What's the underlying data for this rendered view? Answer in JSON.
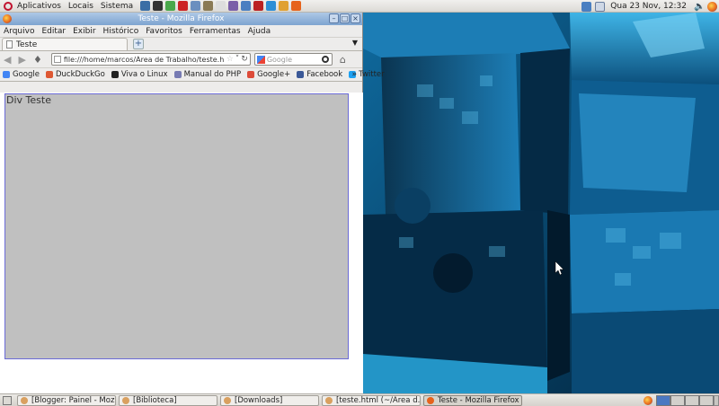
{
  "top_panel": {
    "menus": [
      "Aplicativos",
      "Locais",
      "Sistema"
    ],
    "launchers": [
      {
        "icon": "virtualbox-icon",
        "color": "#3a6ea5"
      },
      {
        "icon": "terminal-icon",
        "color": "#333333"
      },
      {
        "icon": "chrome-icon",
        "color": "#4aa84b"
      },
      {
        "icon": "app-icon-red",
        "color": "#cc2222"
      },
      {
        "icon": "network-icon",
        "color": "#6b8fbf"
      },
      {
        "icon": "gimp-icon",
        "color": "#8a7a55"
      },
      {
        "icon": "app-icon-white",
        "color": "#dddddd"
      },
      {
        "icon": "pidgin-icon",
        "color": "#7a5fa8"
      },
      {
        "icon": "app-icon-blue",
        "color": "#4a7fc1"
      },
      {
        "icon": "filezilla-icon",
        "color": "#bb2222"
      },
      {
        "icon": "skype-icon",
        "color": "#2c8ed6"
      },
      {
        "icon": "editor-icon",
        "color": "#e0a030"
      },
      {
        "icon": "firefox-launcher-icon",
        "color": "#e6631c"
      }
    ],
    "clock": "Qua 23 Nov, 12:32"
  },
  "firefox": {
    "window_title": "Teste - Mozilla Firefox",
    "menu": [
      "Arquivo",
      "Editar",
      "Exibir",
      "Histórico",
      "Favoritos",
      "Ferramentas",
      "Ajuda"
    ],
    "tab": {
      "label": "Teste"
    },
    "url": "file:///home/marcos/Área de Trabalho/teste.h",
    "search_placeholder": "Google",
    "bookmarks": [
      {
        "label": "Google",
        "color": "#4285f4"
      },
      {
        "label": "DuckDuckGo",
        "color": "#de5833"
      },
      {
        "label": "Viva o Linux",
        "color": "#222222"
      },
      {
        "label": "Manual do PHP",
        "color": "#777bb3"
      },
      {
        "label": "Google+",
        "color": "#dd4b39"
      },
      {
        "label": "Facebook",
        "color": "#3b5998"
      },
      {
        "label": "Twitter",
        "color": "#1da1f2"
      }
    ],
    "bookmarks_more": "»",
    "page": {
      "div_text": "Div Teste",
      "div_bg": "#c0c0c0"
    }
  },
  "taskbar": {
    "tasks": [
      {
        "label": "[Blogger: Painel - Moz...",
        "active": false
      },
      {
        "label": "[Biblioteca]",
        "active": false
      },
      {
        "label": "[Downloads]",
        "active": false
      },
      {
        "label": "[teste.html (~/Área d...",
        "active": false
      },
      {
        "label": "Teste - Mozilla Firefox",
        "active": true
      }
    ]
  }
}
